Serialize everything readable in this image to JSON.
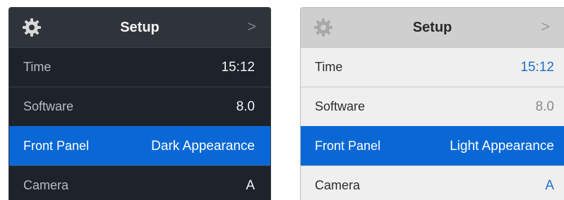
{
  "colors": {
    "selected_bg": "#0a68d6",
    "dark_bg": "#1d222b",
    "dark_header": "#2f343a",
    "light_bg": "#efefef",
    "light_header": "#cfcfcf",
    "light_accent_value": "#1e6fc8"
  },
  "dark_panel": {
    "header": {
      "icon": "gear-icon",
      "title": "Setup",
      "chevron": ">"
    },
    "rows": [
      {
        "label": "Time",
        "value": "15:12"
      },
      {
        "label": "Software",
        "value": "8.0"
      },
      {
        "label": "Front Panel",
        "value": "Dark Appearance",
        "selected": true
      },
      {
        "label": "Camera",
        "value": "A"
      }
    ]
  },
  "light_panel": {
    "header": {
      "icon": "gear-icon",
      "title": "Setup",
      "chevron": ">"
    },
    "rows": [
      {
        "label": "Time",
        "value": "15:12"
      },
      {
        "label": "Software",
        "value": "8.0"
      },
      {
        "label": "Front Panel",
        "value": "Light Appearance",
        "selected": true
      },
      {
        "label": "Camera",
        "value": "A"
      }
    ]
  }
}
